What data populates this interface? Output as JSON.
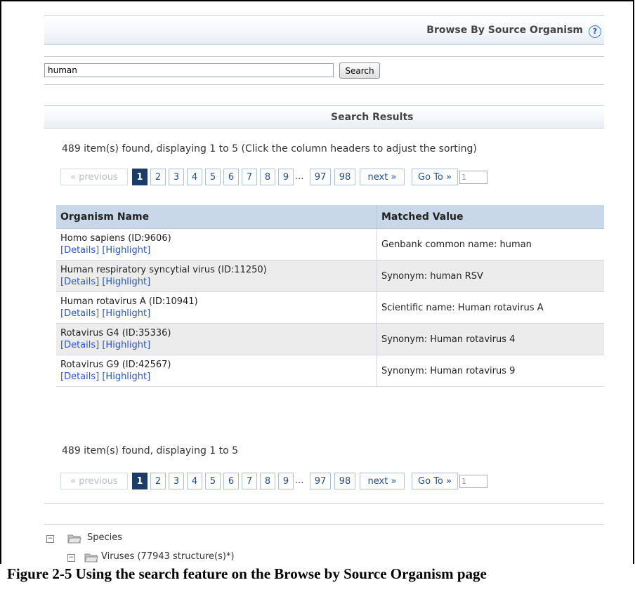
{
  "header": {
    "title": "Browse By Source Organism",
    "help_icon": "?"
  },
  "search": {
    "value": "human",
    "button": "Search"
  },
  "results_header": {
    "title": "Search Results"
  },
  "summary_top": "489 item(s) found, displaying 1 to 5 (Click the column headers to adjust the sorting)",
  "summary_bottom": "489 item(s) found, displaying 1 to 5",
  "pager": {
    "previous": "« previous",
    "pages": [
      "1",
      "2",
      "3",
      "4",
      "5",
      "6",
      "7",
      "8",
      "9"
    ],
    "ellipsis": "...",
    "last_pages": [
      "97",
      "98"
    ],
    "next": "next »",
    "goto": "Go To »",
    "goto_value": "1",
    "current_page": 1
  },
  "table": {
    "columns": [
      "Organism Name",
      "Matched Value"
    ],
    "rows": [
      {
        "name": "Homo sapiens (ID:9606)",
        "details": "[Details]",
        "highlight": "[Highlight]",
        "matched": "Genbank common name: human"
      },
      {
        "name": "Human respiratory syncytial virus (ID:11250)",
        "details": "[Details]",
        "highlight": "[Highlight]",
        "matched": "Synonym: human RSV"
      },
      {
        "name": "Human rotavirus A (ID:10941)",
        "details": "[Details]",
        "highlight": "[Highlight]",
        "matched": "Scientific name: Human rotavirus A"
      },
      {
        "name": "Rotavirus G4 (ID:35336)",
        "details": "[Details]",
        "highlight": "[Highlight]",
        "matched": "Synonym: Human rotavirus 4"
      },
      {
        "name": "Rotavirus G9 (ID:42567)",
        "details": "[Details]",
        "highlight": "[Highlight]",
        "matched": "Synonym: Human rotavirus 9"
      }
    ]
  },
  "tree": {
    "species": {
      "toggle": "−",
      "icon": "folder-icon",
      "label": "Species"
    },
    "viruses": {
      "toggle": "−",
      "icon": "folder-icon",
      "label": "Viruses (77943 structure(s)*)"
    }
  },
  "caption": "Figure 2-5  Using the search feature on the Browse by Source Organism page",
  "colors": {
    "accent": "#1b3c66",
    "link": "#2a55c7",
    "header_band": "#c9d8e8",
    "pager_border": "#a9c1dc"
  }
}
